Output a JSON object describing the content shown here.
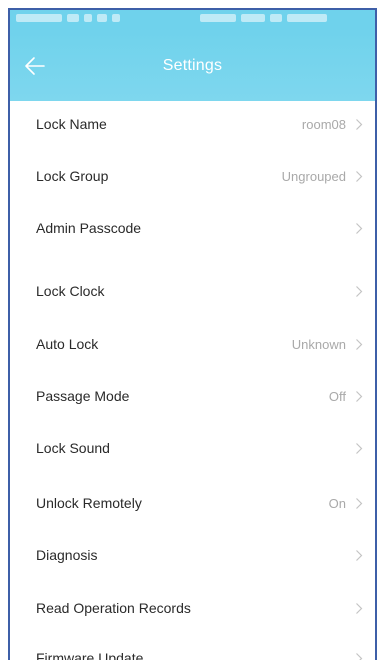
{
  "header": {
    "title": "Settings"
  },
  "settings": [
    {
      "label": "Lock Name",
      "value": "room08"
    },
    {
      "label": "Lock Group",
      "value": "Ungrouped"
    },
    {
      "label": "Admin Passcode",
      "value": ""
    },
    {
      "label": "Lock Clock",
      "value": ""
    },
    {
      "label": "Auto Lock",
      "value": "Unknown"
    },
    {
      "label": "Passage Mode",
      "value": "Off"
    },
    {
      "label": "Lock Sound",
      "value": ""
    },
    {
      "label": "Unlock Remotely",
      "value": "On"
    },
    {
      "label": "Diagnosis",
      "value": ""
    },
    {
      "label": "Read Operation Records",
      "value": ""
    },
    {
      "label": "Firmware Update",
      "value": ""
    }
  ],
  "icons": {
    "back": "back-arrow-icon",
    "chevron": "chevron-right-icon"
  },
  "colors": {
    "header": "#6fd2ec",
    "label_text": "#2a2a2a",
    "value_text": "#a9a9a9",
    "frame_border": "#3e5fa8"
  }
}
